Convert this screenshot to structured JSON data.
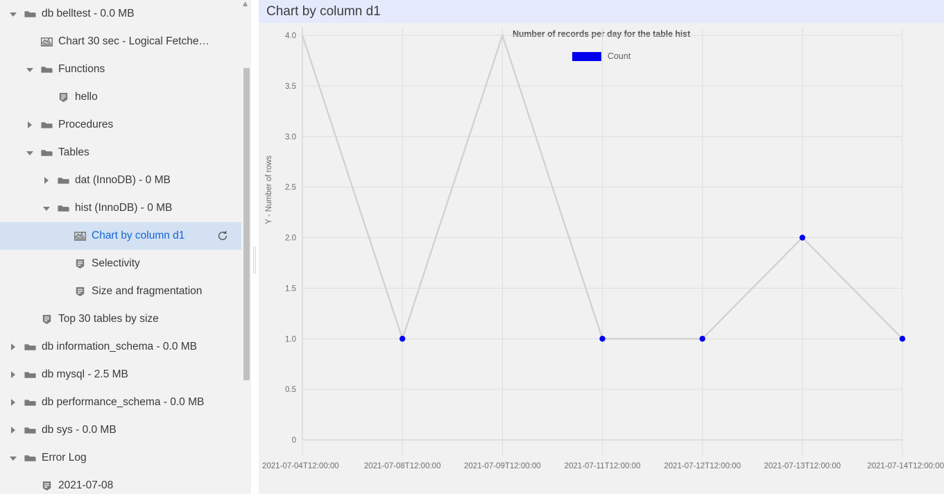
{
  "sidebar": {
    "items": [
      {
        "label": "db belltest - 0.0 MB",
        "icon": "folder-open-icon",
        "twisty": "open",
        "indent": 0,
        "selected": false
      },
      {
        "label": "Chart 30 sec - Logical Fetche…",
        "icon": "chart-icon",
        "twisty": "none",
        "indent": 1,
        "selected": false
      },
      {
        "label": "Functions",
        "icon": "folder-open-icon",
        "twisty": "open",
        "indent": 1,
        "selected": false
      },
      {
        "label": "hello",
        "icon": "script-icon",
        "twisty": "none",
        "indent": 2,
        "selected": false
      },
      {
        "label": "Procedures",
        "icon": "folder-closed-icon",
        "twisty": "closed",
        "indent": 1,
        "selected": false
      },
      {
        "label": "Tables",
        "icon": "folder-open-icon",
        "twisty": "open",
        "indent": 1,
        "selected": false
      },
      {
        "label": "dat (InnoDB) - 0 MB",
        "icon": "folder-closed-icon",
        "twisty": "closed",
        "indent": 2,
        "selected": false
      },
      {
        "label": "hist (InnoDB) - 0 MB",
        "icon": "folder-open-icon",
        "twisty": "open",
        "indent": 2,
        "selected": false
      },
      {
        "label": "Chart by column d1",
        "icon": "chart-icon",
        "twisty": "none",
        "indent": 3,
        "selected": true,
        "action": "refresh-icon"
      },
      {
        "label": "Selectivity",
        "icon": "script-icon",
        "twisty": "none",
        "indent": 3,
        "selected": false
      },
      {
        "label": "Size and fragmentation",
        "icon": "script-icon",
        "twisty": "none",
        "indent": 3,
        "selected": false
      },
      {
        "label": "Top 30 tables by size",
        "icon": "script-icon",
        "twisty": "none",
        "indent": 1,
        "selected": false
      },
      {
        "label": "db information_schema - 0.0 MB",
        "icon": "folder-closed-icon",
        "twisty": "closed",
        "indent": 0,
        "selected": false
      },
      {
        "label": "db mysql - 2.5 MB",
        "icon": "folder-closed-icon",
        "twisty": "closed",
        "indent": 0,
        "selected": false
      },
      {
        "label": "db performance_schema - 0.0 MB",
        "icon": "folder-closed-icon",
        "twisty": "closed",
        "indent": 0,
        "selected": false
      },
      {
        "label": "db sys - 0.0 MB",
        "icon": "folder-closed-icon",
        "twisty": "closed",
        "indent": 0,
        "selected": false
      },
      {
        "label": "Error Log",
        "icon": "folder-open-icon",
        "twisty": "open",
        "indent": 0,
        "selected": false
      },
      {
        "label": "2021-07-08",
        "icon": "script-icon",
        "twisty": "none",
        "indent": 1,
        "selected": false
      }
    ]
  },
  "panel": {
    "title": "Chart by column d1"
  },
  "colors": {
    "header_background": "#e4eafb",
    "selection_background": "#d3e1f3",
    "selection_text": "#1565d8",
    "series_marker": "#0000ee",
    "series_line": "#d2d2d2",
    "plot_background": "#f1f1f1"
  },
  "chart_data": {
    "type": "line",
    "title": "Number of records per day for the table hist",
    "xlabel": "",
    "ylabel": "Y - Number of rows",
    "legend": [
      {
        "name": "Count",
        "color": "#0000ee"
      }
    ],
    "legend_position": "top-center",
    "grid": true,
    "x": [
      "2021-07-04T12:00:00",
      "2021-07-08T12:00:00",
      "2021-07-09T12:00:00",
      "2021-07-11T12:00:00",
      "2021-07-12T12:00:00",
      "2021-07-13T12:00:00",
      "2021-07-14T12:00:00"
    ],
    "xtick_labels": [
      "2021-07-04T12:00:00",
      "2021-07-08T12:00:00",
      "2021-07-09T12:00:00",
      "2021-07-11T12:00:00",
      "2021-07-12T12:00:00",
      "2021-07-13T12:00:00",
      "2021-07-14T12:00:00"
    ],
    "series": [
      {
        "name": "Count",
        "values": [
          4,
          1,
          4,
          1,
          1,
          2,
          1
        ]
      }
    ],
    "ylim": [
      0,
      4
    ],
    "ytick_labels": [
      "0",
      "0.5",
      "1.0",
      "1.5",
      "2.0",
      "2.5",
      "3.0",
      "3.5",
      "4.0"
    ],
    "ytick_values": [
      0,
      0.5,
      1.0,
      1.5,
      2.0,
      2.5,
      3.0,
      3.5,
      4.0
    ]
  }
}
